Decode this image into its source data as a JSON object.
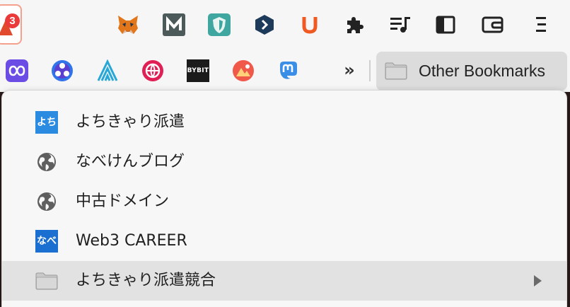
{
  "toolbar": {
    "notification_badge": "3",
    "extensions": [
      {
        "name": "metamask-icon"
      },
      {
        "name": "m-extension-icon",
        "glyph": "M",
        "color": "#4d5a5a"
      },
      {
        "name": "shield-extension-icon",
        "color": "#3fa6a0"
      },
      {
        "name": "arrow-hex-icon",
        "color": "#1e3a5a"
      },
      {
        "name": "u-extension-icon",
        "glyph": "U",
        "color": "#f05a22"
      },
      {
        "name": "puzzle-icon"
      },
      {
        "name": "playlist-icon"
      },
      {
        "name": "sidebar-toggle-icon"
      },
      {
        "name": "wallet-icon"
      },
      {
        "name": "menu-icon"
      }
    ]
  },
  "bookmarks_bar": {
    "overflow_glyph": "»",
    "other_bookmarks_label": "Other Bookmarks",
    "icons": [
      {
        "name": "infinity-icon",
        "color": "#6b4de6"
      },
      {
        "name": "triangle-orb-icon",
        "color": "#2f74e8"
      },
      {
        "name": "arch-icon",
        "color": "#27a6d8"
      },
      {
        "name": "globe-pink-icon",
        "color": "#e01f54"
      },
      {
        "name": "bybit-icon",
        "label": "BYBIT",
        "color": "#1b1b1b"
      },
      {
        "name": "nft-art-icon",
        "color": "#f0584a"
      },
      {
        "name": "mastodon-icon",
        "color": "#3a8ee6"
      }
    ]
  },
  "menu": {
    "items": [
      {
        "label": "よちきゃり派遣",
        "icon": "yochi-icon",
        "icon_text": "よち",
        "icon_color": "#2a8be0"
      },
      {
        "label": "なべけんブログ",
        "icon": "globe-icon"
      },
      {
        "label": "中古ドメイン",
        "icon": "globe-icon"
      },
      {
        "label": "Web3 CAREER",
        "icon": "nabe-icon",
        "icon_text": "なべ",
        "icon_color": "#1b6fd0"
      },
      {
        "label": "よちきゃり派遣競合",
        "icon": "folder-icon",
        "has_submenu": true
      }
    ]
  }
}
